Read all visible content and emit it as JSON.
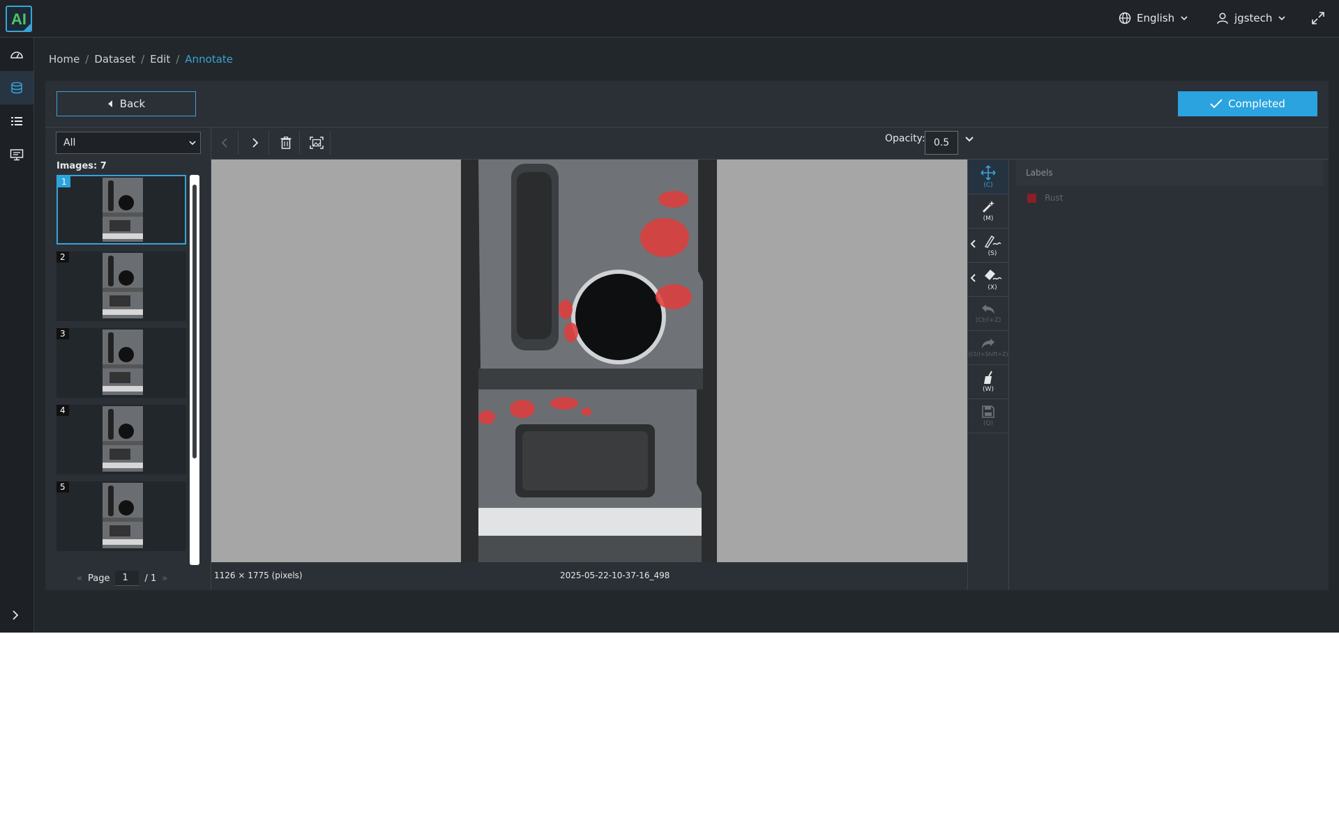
{
  "app": {
    "logo_text": "AI",
    "language": "English",
    "username": "jgstech"
  },
  "sidebar": {
    "items": [
      {
        "name": "dashboard-icon"
      },
      {
        "name": "dataset-icon",
        "active": true
      },
      {
        "name": "list-icon"
      },
      {
        "name": "monitor-icon"
      }
    ]
  },
  "breadcrumb": {
    "items": [
      "Home",
      "Dataset",
      "Edit"
    ],
    "current": "Annotate"
  },
  "actions": {
    "back_label": "Back",
    "completed_label": "Completed"
  },
  "filter": {
    "selected": "All",
    "images_count": "Images: 7"
  },
  "thumbnails": [
    "1",
    "2",
    "3",
    "4",
    "5"
  ],
  "pager": {
    "label": "Page",
    "current": "1",
    "total": "/ 1"
  },
  "toolbar": {
    "opacity_label": "Opacity:",
    "opacity_value": "0.5"
  },
  "image": {
    "dimensions": "1126 × 1775 (pixels)",
    "filename": "2025-05-22-10-37-16_498"
  },
  "tools": [
    {
      "name": "move-tool",
      "key": "(C)",
      "active": true,
      "disabled": false
    },
    {
      "name": "magic-wand-tool",
      "key": "(M)",
      "active": false,
      "disabled": false
    },
    {
      "name": "brush-tool",
      "key": "(S)",
      "active": false,
      "disabled": false
    },
    {
      "name": "eraser-tool",
      "key": "(X)",
      "active": false,
      "disabled": false
    },
    {
      "name": "undo-tool",
      "key": "(Ctrl+Z)",
      "active": false,
      "disabled": true
    },
    {
      "name": "redo-tool",
      "key": "(Ctrl+Shift+Z)",
      "active": false,
      "disabled": true
    },
    {
      "name": "clear-tool",
      "key": "(W)",
      "active": false,
      "disabled": false
    },
    {
      "name": "save-tool",
      "key": "(Q)",
      "active": false,
      "disabled": true
    }
  ],
  "labels_panel": {
    "title": "Labels",
    "items": [
      {
        "name": "Rust",
        "color": "#8a1f24"
      }
    ]
  },
  "colors": {
    "accent": "#2aa3df",
    "annotation": "#e23c3c"
  }
}
